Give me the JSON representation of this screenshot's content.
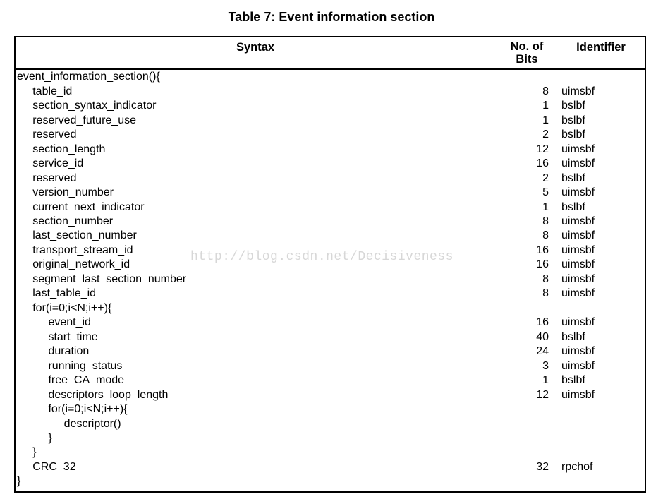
{
  "title": "Table 7: Event information section",
  "headers": {
    "syntax": "Syntax",
    "bits": "No. of\nBits",
    "identifier": "Identifier"
  },
  "watermark": "http://blog.csdn.net/Decisiveness",
  "chart_data": {
    "type": "table",
    "title": "Table 7: Event information section",
    "columns": [
      "Syntax",
      "No. of Bits",
      "Identifier"
    ],
    "rows": [
      [
        "event_information_section(){",
        "",
        ""
      ],
      [
        "table_id",
        "8",
        "uimsbf"
      ],
      [
        "section_syntax_indicator",
        "1",
        "bslbf"
      ],
      [
        "reserved_future_use",
        "1",
        "bslbf"
      ],
      [
        "reserved",
        "2",
        "bslbf"
      ],
      [
        "section_length",
        "12",
        "uimsbf"
      ],
      [
        "service_id",
        "16",
        "uimsbf"
      ],
      [
        "reserved",
        "2",
        "bslbf"
      ],
      [
        "version_number",
        "5",
        "uimsbf"
      ],
      [
        "current_next_indicator",
        "1",
        "bslbf"
      ],
      [
        "section_number",
        "8",
        "uimsbf"
      ],
      [
        "last_section_number",
        "8",
        "uimsbf"
      ],
      [
        "transport_stream_id",
        "16",
        "uimsbf"
      ],
      [
        "original_network_id",
        "16",
        "uimsbf"
      ],
      [
        "segment_last_section_number",
        "8",
        "uimsbf"
      ],
      [
        "last_table_id",
        "8",
        "uimsbf"
      ],
      [
        "for(i=0;i<N;i++){",
        "",
        ""
      ],
      [
        "event_id",
        "16",
        "uimsbf"
      ],
      [
        "start_time",
        "40",
        "bslbf"
      ],
      [
        "duration",
        "24",
        "uimsbf"
      ],
      [
        "running_status",
        "3",
        "uimsbf"
      ],
      [
        "free_CA_mode",
        "1",
        "bslbf"
      ],
      [
        "descriptors_loop_length",
        "12",
        "uimsbf"
      ],
      [
        "for(i=0;i<N;i++){",
        "",
        ""
      ],
      [
        "descriptor()",
        "",
        ""
      ],
      [
        "}",
        "",
        ""
      ],
      [
        "}",
        "",
        ""
      ],
      [
        "CRC_32",
        "32",
        "rpchof"
      ],
      [
        "}",
        "",
        ""
      ]
    ]
  },
  "rows": [
    {
      "indent": 0,
      "syntax": "event_information_section(){",
      "bits": "",
      "ident": ""
    },
    {
      "indent": 1,
      "syntax": "table_id",
      "bits": "8",
      "ident": "uimsbf"
    },
    {
      "indent": 1,
      "syntax": "section_syntax_indicator",
      "bits": "1",
      "ident": "bslbf"
    },
    {
      "indent": 1,
      "syntax": "reserved_future_use",
      "bits": "1",
      "ident": "bslbf"
    },
    {
      "indent": 1,
      "syntax": "reserved",
      "bits": "2",
      "ident": "bslbf"
    },
    {
      "indent": 1,
      "syntax": "section_length",
      "bits": "12",
      "ident": "uimsbf"
    },
    {
      "indent": 1,
      "syntax": "service_id",
      "bits": "16",
      "ident": "uimsbf"
    },
    {
      "indent": 1,
      "syntax": "reserved",
      "bits": "2",
      "ident": "bslbf"
    },
    {
      "indent": 1,
      "syntax": "version_number",
      "bits": "5",
      "ident": "uimsbf"
    },
    {
      "indent": 1,
      "syntax": "current_next_indicator",
      "bits": "1",
      "ident": "bslbf"
    },
    {
      "indent": 1,
      "syntax": "section_number",
      "bits": "8",
      "ident": "uimsbf"
    },
    {
      "indent": 1,
      "syntax": "last_section_number",
      "bits": "8",
      "ident": "uimsbf"
    },
    {
      "indent": 1,
      "syntax": "transport_stream_id",
      "bits": "16",
      "ident": "uimsbf"
    },
    {
      "indent": 1,
      "syntax": "original_network_id",
      "bits": "16",
      "ident": "uimsbf"
    },
    {
      "indent": 1,
      "syntax": "segment_last_section_number",
      "bits": "8",
      "ident": "uimsbf"
    },
    {
      "indent": 1,
      "syntax": "last_table_id",
      "bits": "8",
      "ident": "uimsbf"
    },
    {
      "indent": 1,
      "syntax": "for(i=0;i<N;i++){",
      "bits": "",
      "ident": ""
    },
    {
      "indent": 2,
      "syntax": "event_id",
      "bits": "16",
      "ident": "uimsbf"
    },
    {
      "indent": 2,
      "syntax": "start_time",
      "bits": "40",
      "ident": "bslbf"
    },
    {
      "indent": 2,
      "syntax": "duration",
      "bits": "24",
      "ident": "uimsbf"
    },
    {
      "indent": 2,
      "syntax": "running_status",
      "bits": "3",
      "ident": "uimsbf"
    },
    {
      "indent": 2,
      "syntax": "free_CA_mode",
      "bits": "1",
      "ident": "bslbf"
    },
    {
      "indent": 2,
      "syntax": "descriptors_loop_length",
      "bits": "12",
      "ident": "uimsbf"
    },
    {
      "indent": 2,
      "syntax": "for(i=0;i<N;i++){",
      "bits": "",
      "ident": ""
    },
    {
      "indent": 3,
      "syntax": "descriptor()",
      "bits": "",
      "ident": ""
    },
    {
      "indent": 2,
      "syntax": "}",
      "bits": "",
      "ident": ""
    },
    {
      "indent": 1,
      "syntax": "}",
      "bits": "",
      "ident": ""
    },
    {
      "indent": 1,
      "syntax": "CRC_32",
      "bits": "32",
      "ident": "rpchof"
    },
    {
      "indent": 0,
      "syntax": "}",
      "bits": "",
      "ident": ""
    }
  ]
}
